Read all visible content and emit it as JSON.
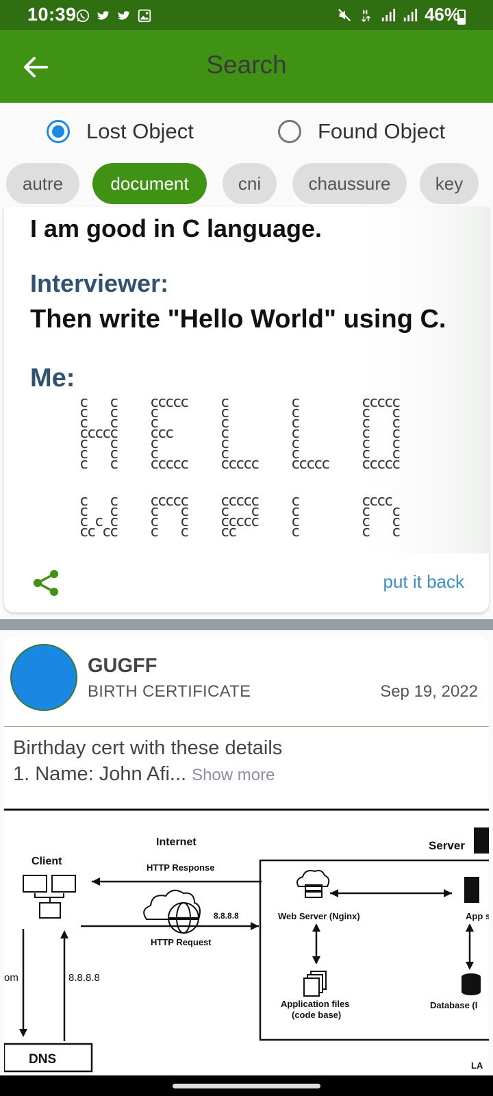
{
  "status_bar": {
    "time": "10:39",
    "battery": "46%",
    "left_icons": [
      "whatsapp-icon",
      "twitter-icon",
      "twitter-icon",
      "gallery-icon"
    ],
    "right_icons": [
      "mute-icon",
      "hplus-data-icon",
      "signal-icon",
      "signal-icon",
      "battery-icon"
    ]
  },
  "app_bar": {
    "title": "Search",
    "back_icon": "arrow-left-icon"
  },
  "filter": {
    "options": [
      {
        "label": "Lost Object",
        "checked": true
      },
      {
        "label": "Found Object",
        "checked": false
      }
    ]
  },
  "chips": [
    {
      "label": "autre",
      "selected": false
    },
    {
      "label": "document",
      "selected": true
    },
    {
      "label": "cni",
      "selected": false
    },
    {
      "label": "chaussure",
      "selected": false
    },
    {
      "label": "key",
      "selected": false
    }
  ],
  "card1": {
    "image": {
      "line1": "I am good in C language.",
      "line2": "Interviewer:",
      "line3": "Then write \"Hello World\" using C.",
      "line4": "Me:"
    },
    "share_icon": "share-icon",
    "action": "put it back"
  },
  "card2": {
    "name": "GUGFF",
    "category": "BIRTH CERTIFICATE",
    "date": "Sep 19, 2022",
    "description_line1": "Birthday cert with these details",
    "description_line2": "1. Name: John Afi...",
    "show_more": "Show more",
    "diagram": {
      "internet": "Internet",
      "server": "Server",
      "client": "Client",
      "http_response": "HTTP Response",
      "http_request": "HTTP Request",
      "ip1": "8.8.8.8",
      "ip2": "8.8.8.8",
      "web_server": "Web Server (Nginx)",
      "app_server": "App se",
      "app_files_1": "Application files",
      "app_files_2": "(code base)",
      "database": "Database (I",
      "dns": "DNS",
      "om": "om",
      "la": "LA"
    }
  },
  "colors": {
    "status_bar": "#2f6f12",
    "app_bar": "#3f9214",
    "chip_selected": "#3f9214",
    "radio_active": "#1e88e5",
    "link": "#3a8fce",
    "avatar": "#1a87e2"
  }
}
